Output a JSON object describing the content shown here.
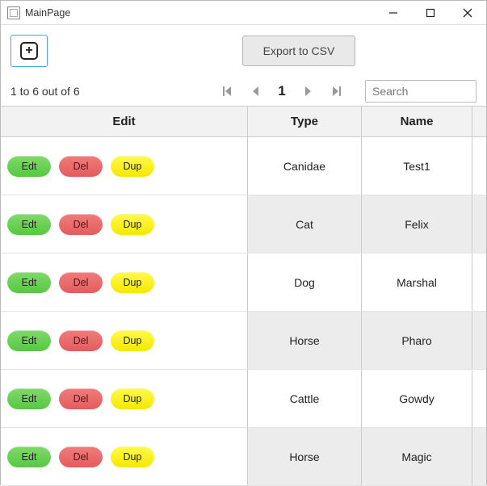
{
  "window": {
    "title": "MainPage"
  },
  "toolbar": {
    "export_label": "Export to CSV"
  },
  "pager": {
    "count_text": "1 to 6 out of 6",
    "current_page": "1",
    "search_placeholder": "Search"
  },
  "grid": {
    "headers": {
      "edit": "Edit",
      "type": "Type",
      "name": "Name"
    },
    "action_labels": {
      "edit": "Edt",
      "delete": "Del",
      "duplicate": "Dup"
    },
    "rows": [
      {
        "type": "Canidae",
        "name": "Test1"
      },
      {
        "type": "Cat",
        "name": "Felix"
      },
      {
        "type": "Dog",
        "name": "Marshal"
      },
      {
        "type": "Horse",
        "name": "Pharo"
      },
      {
        "type": "Cattle",
        "name": "Gowdy"
      },
      {
        "type": "Horse",
        "name": "Magic"
      }
    ]
  }
}
